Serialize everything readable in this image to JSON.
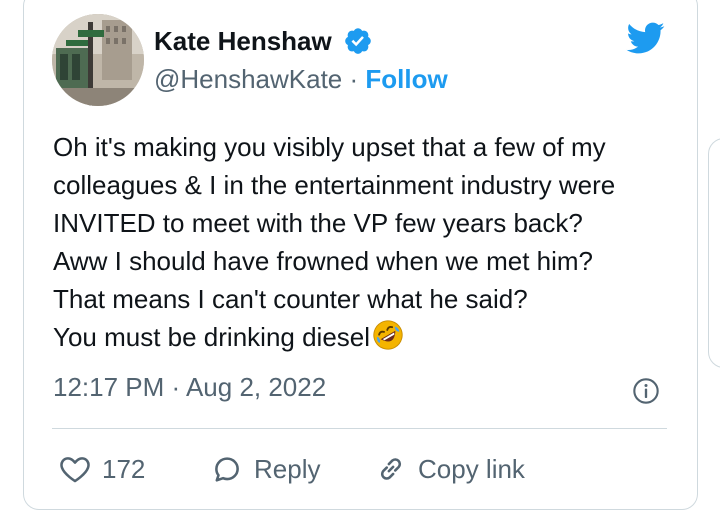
{
  "author": {
    "name": "Kate Henshaw",
    "handle": "@HenshawKate",
    "separator": "·",
    "follow_label": "Follow",
    "verified": true
  },
  "tweet": {
    "lines": [
      "Oh it's making you visibly upset that a few of my",
      "colleagues & I in the entertainment industry were",
      "INVITED to meet with the VP few years back?",
      "Aww I should have frowned when we met him?",
      "That means I can't counter what he said?",
      "You must be drinking diesel"
    ],
    "trailing_emoji": "rolling-on-floor-laughing-emoji",
    "timestamp": "12:17 PM · Aug 2, 2022"
  },
  "actions": {
    "like_count": "172",
    "reply_label": "Reply",
    "copy_link_label": "Copy link"
  },
  "icons": {
    "platform": "twitter-bird-icon",
    "verified": "verified-badge-icon",
    "info": "info-icon",
    "like": "heart-icon",
    "reply": "speech-bubble-icon",
    "copy": "link-icon"
  },
  "colors": {
    "brand_blue": "#1d9bf0",
    "text_primary": "#0f1419",
    "text_secondary": "#536471",
    "border": "#cfd9de"
  }
}
